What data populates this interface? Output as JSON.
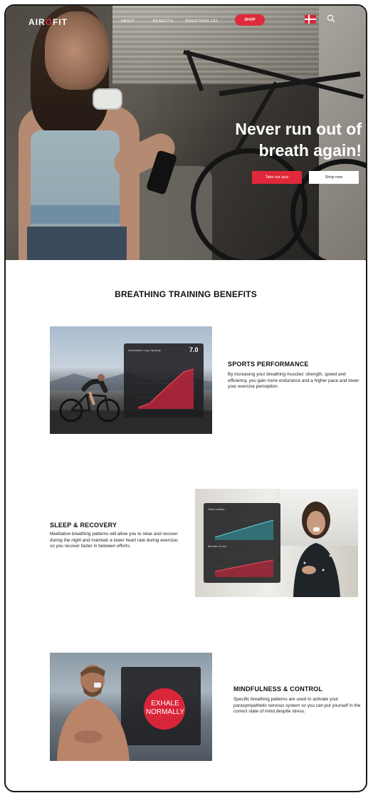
{
  "header": {
    "logo": {
      "left": "AIR",
      "o": "O",
      "right": "FIT"
    },
    "nav": [
      "ABOUT",
      "BENEFITS",
      "BREATHING 101"
    ],
    "shop_label": "SHOP"
  },
  "hero": {
    "headline_line1": "Never run out of",
    "headline_line2": "breath again!",
    "cta_primary": "Take our quiz",
    "cta_secondary": "Shop now"
  },
  "benefits": {
    "section_title": "BREATHING TRAINING BENEFITS",
    "items": [
      {
        "title": "SPORTS PERFORMANCE",
        "text": "By increasing your breathing muscles' strength, speed and efficiency, you gain more endurance and a higher pace and lower your exercise perception.",
        "card": {
          "label": "Accessible Lung Capacity",
          "value": "7.0"
        }
      },
      {
        "title": "SLEEP & RECOVERY",
        "text": "Meditative breathing patterns will allow you to relax and recover during the night and maintain a lower heart rate during exercise, so you recover faster in between efforts.",
        "card": {
          "label_top": "Hours asleep",
          "label_bottom": "Minutes of rest"
        }
      },
      {
        "title": "MINDFULNESS & CONTROL",
        "text": "Specific breathing patterns are used to activate your parasympathetic nervous system so you can put yourself in the correct state of mind despite stress.",
        "card": {
          "line1": "EXHALE",
          "line2": "NORMALLY"
        }
      }
    ]
  },
  "colors": {
    "accent": "#e0293a",
    "text": "#111111"
  },
  "icons": [
    "search-icon",
    "flag-icon"
  ]
}
